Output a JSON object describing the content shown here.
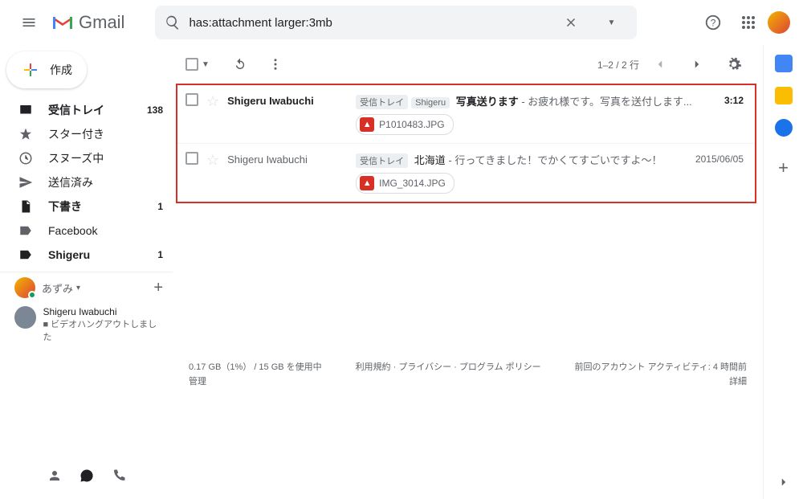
{
  "header": {
    "logo_text": "Gmail",
    "search_value": "has:attachment larger:3mb"
  },
  "compose_label": "作成",
  "nav": [
    {
      "icon": "inbox",
      "label": "受信トレイ",
      "count": "138",
      "bold": true
    },
    {
      "icon": "star",
      "label": "スター付き",
      "count": "",
      "bold": false
    },
    {
      "icon": "clock",
      "label": "スヌーズ中",
      "count": "",
      "bold": false
    },
    {
      "icon": "send",
      "label": "送信済み",
      "count": "",
      "bold": false
    },
    {
      "icon": "draft",
      "label": "下書き",
      "count": "1",
      "bold": true
    },
    {
      "icon": "label",
      "label": "Facebook",
      "count": "",
      "bold": false
    },
    {
      "icon": "label",
      "label": "Shigeru",
      "count": "1",
      "bold": true
    }
  ],
  "hangouts": {
    "me": "あずみ",
    "contact_name": "Shigeru Iwabuchi",
    "contact_status": "ビデオハングアウトしました"
  },
  "toolbar": {
    "range": "1–2 / 2 行"
  },
  "messages": [
    {
      "sender": "Shigeru Iwabuchi",
      "tags": [
        "受信トレイ",
        "Shigeru"
      ],
      "subject": "写真送ります",
      "snippet": " - お疲れ様です。写真を送付します...",
      "attachment": "P1010483.JPG",
      "date": "3:12",
      "unread": true
    },
    {
      "sender": "Shigeru Iwabuchi",
      "tags": [
        "受信トレイ"
      ],
      "subject": "北海道",
      "snippet": " - 行ってきました！でかくてすごいですよ～！",
      "attachment": "IMG_3014.JPG",
      "date": "2015/06/05",
      "unread": false
    }
  ],
  "footer": {
    "storage_line": "0.17 GB（1%） / 15 GB を使用中",
    "storage_manage": "管理",
    "policies": "利用規約 · プライバシー · プログラム ポリシー",
    "activity_line": "前回のアカウント アクティビティ: 4 時間前",
    "details": "詳細"
  }
}
